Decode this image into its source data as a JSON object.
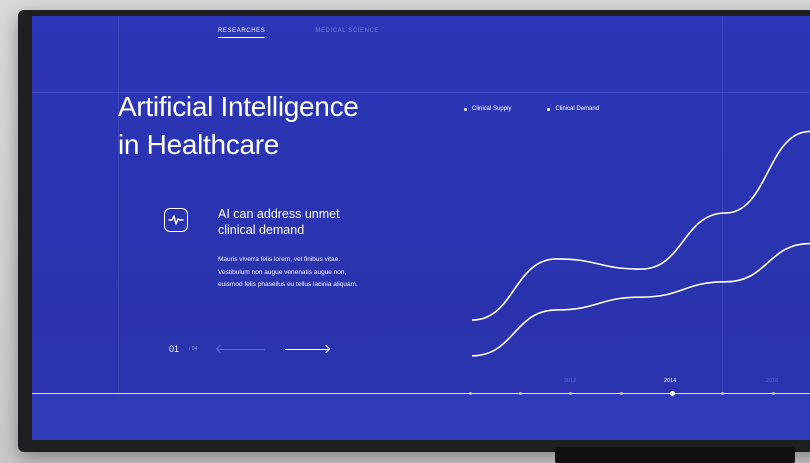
{
  "nav": {
    "items": [
      {
        "label": "RESEARCHES",
        "active": true
      },
      {
        "label": "MEDICAL SCIENCE",
        "active": false
      }
    ]
  },
  "hero": {
    "title": "Artificial Intelligence\nin Healthcare"
  },
  "feature": {
    "icon": "heartbeat-icon",
    "title": "AI can address unmet\nclinical demand",
    "body": "Mauris viverra felis lorem, vel finibus vitae. Vestibulum non augue venenatis augue non, euismod felis phasellus eu tellus lacinia aliquam."
  },
  "pager": {
    "current": "01",
    "total": "/ 04"
  },
  "chart_data": {
    "type": "line",
    "legend": [
      "Clinical Supply",
      "Clinical Demand"
    ],
    "x": [
      "2012",
      "2014",
      "2016"
    ],
    "selected_x": "2014",
    "grid": true,
    "series": [
      {
        "name": "Clinical Demand",
        "values": [
          0.18,
          0.42,
          0.38,
          0.6,
          0.92
        ]
      },
      {
        "name": "Clinical Supply",
        "values": [
          0.04,
          0.22,
          0.27,
          0.33,
          0.48
        ]
      }
    ]
  },
  "colors": {
    "background": "#2b36b8",
    "accent": "#ffffff"
  }
}
